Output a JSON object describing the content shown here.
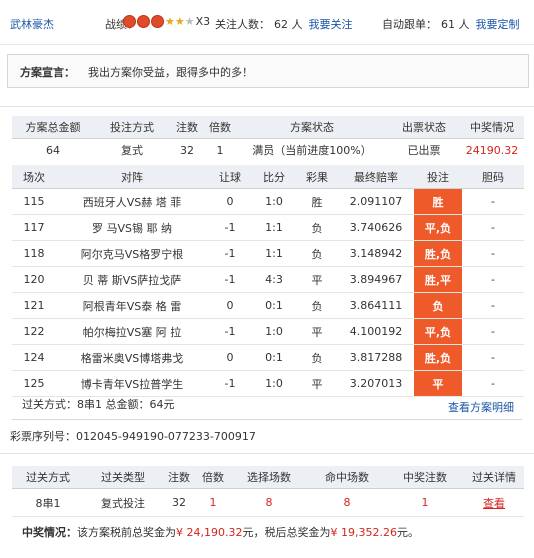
{
  "topbar": {
    "user": "武林豪杰",
    "rank_label": "战绩：",
    "rank_multiplier": "X3",
    "follow_label": "关注人数：",
    "follow_count": "62 人",
    "follow_link": "我要关注",
    "auto_label": "自动跟单：",
    "auto_count": "61 人",
    "auto_link": "我要定制"
  },
  "declaration": {
    "label": "方案宣言：",
    "text": "我出方案你受益，跟得多中的多！"
  },
  "summary": {
    "headers": [
      "方案总金额",
      "投注方式",
      "注数",
      "倍数",
      "方案状态",
      "出票状态",
      "中奖情况"
    ],
    "row": {
      "amount": "64",
      "method": "复式",
      "bets": "32",
      "multiple": "1",
      "status": "满员（当前进度100%）",
      "ticket": "已出票",
      "prize": "24190.32"
    }
  },
  "matches": {
    "headers": [
      "场次",
      "对阵",
      "让球",
      "比分",
      "彩果",
      "最终赔率",
      "投注",
      "胆码"
    ],
    "rows": [
      {
        "no": "115",
        "vs": "西班牙人VS赫 塔 菲",
        "hcp": "0",
        "score": "1:0",
        "result": "胜",
        "odds": "2.091107",
        "bet": "胜",
        "banker": "-"
      },
      {
        "no": "117",
        "vs": "罗 马VS锡 耶 纳",
        "hcp": "-1",
        "score": "1:1",
        "result": "负",
        "odds": "3.740626",
        "bet": "平,负",
        "banker": "-"
      },
      {
        "no": "118",
        "vs": "阿尔克马VS格罗宁根",
        "hcp": "-1",
        "score": "1:1",
        "result": "负",
        "odds": "3.148942",
        "bet": "胜,负",
        "banker": "-"
      },
      {
        "no": "120",
        "vs": "贝 蒂 斯VS萨拉戈萨",
        "hcp": "-1",
        "score": "4:3",
        "result": "平",
        "odds": "3.894967",
        "bet": "胜,平",
        "banker": "-"
      },
      {
        "no": "121",
        "vs": "阿根青年VS泰 格 雷",
        "hcp": "0",
        "score": "0:1",
        "result": "负",
        "odds": "3.864111",
        "bet": "负",
        "banker": "-"
      },
      {
        "no": "122",
        "vs": "帕尔梅拉VS塞 阿 拉",
        "hcp": "-1",
        "score": "1:0",
        "result": "平",
        "odds": "4.100192",
        "bet": "平,负",
        "banker": "-"
      },
      {
        "no": "124",
        "vs": "格雷米奥VS博塔弗戈",
        "hcp": "0",
        "score": "0:1",
        "result": "负",
        "odds": "3.817288",
        "bet": "胜,负",
        "banker": "-"
      },
      {
        "no": "125",
        "vs": "博卡青年VS拉普学生",
        "hcp": "-1",
        "score": "1:0",
        "result": "平",
        "odds": "3.207013",
        "bet": "平",
        "banker": "-"
      }
    ]
  },
  "pass_info": "过关方式：8串1 总金额：64元",
  "view_detail_link": "查看方案明细",
  "serial": "彩票序列号：012045-949190-077233-700917",
  "pass_table": {
    "headers": [
      "过关方式",
      "过关类型",
      "注数",
      "倍数",
      "选择场数",
      "命中场数",
      "中奖注数",
      "过关详情"
    ],
    "row": {
      "mode": "8串1",
      "type": "复式投注",
      "bets": "32",
      "multiple": "1",
      "chosen": "8",
      "hit": "8",
      "won": "1",
      "detail": "查看"
    }
  },
  "prize_line": {
    "label": "中奖情况：",
    "pre": "该方案税前总奖金为",
    "pre_amount": "¥ 24,190.32",
    "mid": "元，税后总奖金为",
    "post_amount": "¥ 19,352.26",
    "end": "元。"
  },
  "colors": {
    "accent_red": "#d6251c",
    "bet_cell": "#ef5a2b",
    "link": "#1a56a8",
    "header_bg": "#eceff3"
  }
}
